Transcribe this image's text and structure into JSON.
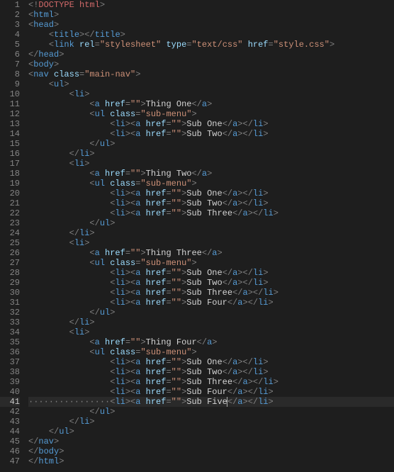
{
  "colors": {
    "background": "#1e1e1e",
    "gutterText": "#858585",
    "tag": "#569cd6",
    "bracket": "#808080",
    "attr": "#9cdcfe",
    "string": "#ce9178",
    "doctype": "#d16969"
  },
  "activeLine": 41,
  "lines": [
    {
      "n": 1,
      "indent": 0,
      "t": "doctype",
      "text": "DOCTYPE html"
    },
    {
      "n": 2,
      "indent": 0,
      "t": "open",
      "tag": "html"
    },
    {
      "n": 3,
      "indent": 0,
      "t": "open",
      "tag": "head"
    },
    {
      "n": 4,
      "indent": 1,
      "t": "pair",
      "tag": "title",
      "inner": ""
    },
    {
      "n": 5,
      "indent": 1,
      "t": "link",
      "attrs": [
        [
          "rel",
          "stylesheet"
        ],
        [
          "type",
          "text/css"
        ],
        [
          "href",
          "style.css"
        ]
      ]
    },
    {
      "n": 6,
      "indent": 0,
      "t": "close",
      "tag": "head"
    },
    {
      "n": 7,
      "indent": 0,
      "t": "open",
      "tag": "body"
    },
    {
      "n": 8,
      "indent": 0,
      "t": "open",
      "tag": "nav",
      "attrs": [
        [
          "class",
          "main-nav"
        ]
      ]
    },
    {
      "n": 9,
      "indent": 1,
      "t": "open",
      "tag": "ul"
    },
    {
      "n": 10,
      "indent": 2,
      "t": "open",
      "tag": "li"
    },
    {
      "n": 11,
      "indent": 3,
      "t": "a",
      "href": "",
      "text": "Thing One"
    },
    {
      "n": 12,
      "indent": 3,
      "t": "open",
      "tag": "ul",
      "attrs": [
        [
          "class",
          "sub-menu"
        ]
      ]
    },
    {
      "n": 13,
      "indent": 4,
      "t": "lia",
      "href": "",
      "text": "Sub One"
    },
    {
      "n": 14,
      "indent": 4,
      "t": "lia",
      "href": "",
      "text": "Sub Two"
    },
    {
      "n": 15,
      "indent": 3,
      "t": "close",
      "tag": "ul"
    },
    {
      "n": 16,
      "indent": 2,
      "t": "close",
      "tag": "li"
    },
    {
      "n": 17,
      "indent": 2,
      "t": "open",
      "tag": "li"
    },
    {
      "n": 18,
      "indent": 3,
      "t": "a",
      "href": "",
      "text": "Thing Two"
    },
    {
      "n": 19,
      "indent": 3,
      "t": "open",
      "tag": "ul",
      "attrs": [
        [
          "class",
          "sub-menu"
        ]
      ]
    },
    {
      "n": 20,
      "indent": 4,
      "t": "lia",
      "href": "",
      "text": "Sub One"
    },
    {
      "n": 21,
      "indent": 4,
      "t": "lia",
      "href": "",
      "text": "Sub Two"
    },
    {
      "n": 22,
      "indent": 4,
      "t": "lia",
      "href": "",
      "text": "Sub Three"
    },
    {
      "n": 23,
      "indent": 3,
      "t": "close",
      "tag": "ul"
    },
    {
      "n": 24,
      "indent": 2,
      "t": "close",
      "tag": "li"
    },
    {
      "n": 25,
      "indent": 2,
      "t": "open",
      "tag": "li"
    },
    {
      "n": 26,
      "indent": 3,
      "t": "a",
      "href": "",
      "text": "Thing Three"
    },
    {
      "n": 27,
      "indent": 3,
      "t": "open",
      "tag": "ul",
      "attrs": [
        [
          "class",
          "sub-menu"
        ]
      ]
    },
    {
      "n": 28,
      "indent": 4,
      "t": "lia",
      "href": "",
      "text": "Sub One"
    },
    {
      "n": 29,
      "indent": 4,
      "t": "lia",
      "href": "",
      "text": "Sub Two"
    },
    {
      "n": 30,
      "indent": 4,
      "t": "lia",
      "href": "",
      "text": "Sub Three"
    },
    {
      "n": 31,
      "indent": 4,
      "t": "lia",
      "href": "",
      "text": "Sub Four"
    },
    {
      "n": 32,
      "indent": 3,
      "t": "close",
      "tag": "ul"
    },
    {
      "n": 33,
      "indent": 2,
      "t": "close",
      "tag": "li"
    },
    {
      "n": 34,
      "indent": 2,
      "t": "open",
      "tag": "li"
    },
    {
      "n": 35,
      "indent": 3,
      "t": "a",
      "href": "",
      "text": "Thing Four"
    },
    {
      "n": 36,
      "indent": 3,
      "t": "open",
      "tag": "ul",
      "attrs": [
        [
          "class",
          "sub-menu"
        ]
      ]
    },
    {
      "n": 37,
      "indent": 4,
      "t": "lia",
      "href": "",
      "text": "Sub One"
    },
    {
      "n": 38,
      "indent": 4,
      "t": "lia",
      "href": "",
      "text": "Sub Two"
    },
    {
      "n": 39,
      "indent": 4,
      "t": "lia",
      "href": "",
      "text": "Sub Three"
    },
    {
      "n": 40,
      "indent": 4,
      "t": "lia",
      "href": "",
      "text": "Sub Four"
    },
    {
      "n": 41,
      "indent": 4,
      "t": "lia",
      "href": "",
      "text": "Sub Five",
      "cursor": true,
      "dots": true
    },
    {
      "n": 42,
      "indent": 3,
      "t": "close",
      "tag": "ul"
    },
    {
      "n": 43,
      "indent": 2,
      "t": "close",
      "tag": "li"
    },
    {
      "n": 44,
      "indent": 1,
      "t": "close",
      "tag": "ul"
    },
    {
      "n": 45,
      "indent": 0,
      "t": "close",
      "tag": "nav"
    },
    {
      "n": 46,
      "indent": 0,
      "t": "close",
      "tag": "body"
    },
    {
      "n": 47,
      "indent": 0,
      "t": "close",
      "tag": "html"
    }
  ]
}
